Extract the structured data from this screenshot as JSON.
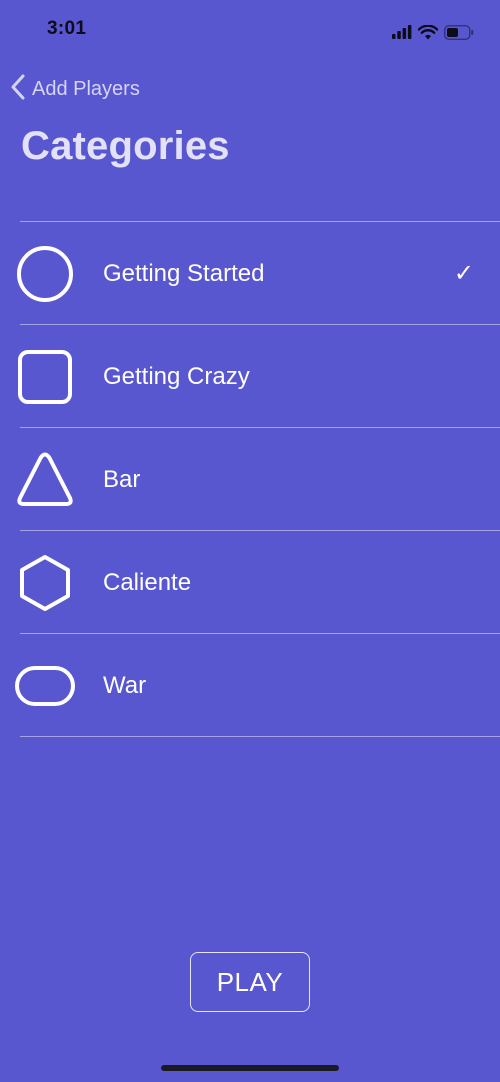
{
  "status_bar": {
    "time": "3:01",
    "icons": [
      "cellular-signal-icon",
      "wifi-icon",
      "battery-icon"
    ]
  },
  "nav": {
    "back_label": "Add Players",
    "title": "Categories"
  },
  "categories": [
    {
      "label": "Getting Started",
      "icon": "circle-icon",
      "selected": true,
      "check": "✓"
    },
    {
      "label": "Getting Crazy",
      "icon": "square-icon",
      "selected": false
    },
    {
      "label": "Bar",
      "icon": "triangle-icon",
      "selected": false
    },
    {
      "label": "Caliente",
      "icon": "hexagon-icon",
      "selected": false
    },
    {
      "label": "War",
      "icon": "rounded-rectangle-icon",
      "selected": false
    }
  ],
  "play_button": {
    "label": "PLAY"
  },
  "colors": {
    "background": "#5957CF",
    "text": "#FFFFFF",
    "nav_text": "#D5D4F4"
  }
}
